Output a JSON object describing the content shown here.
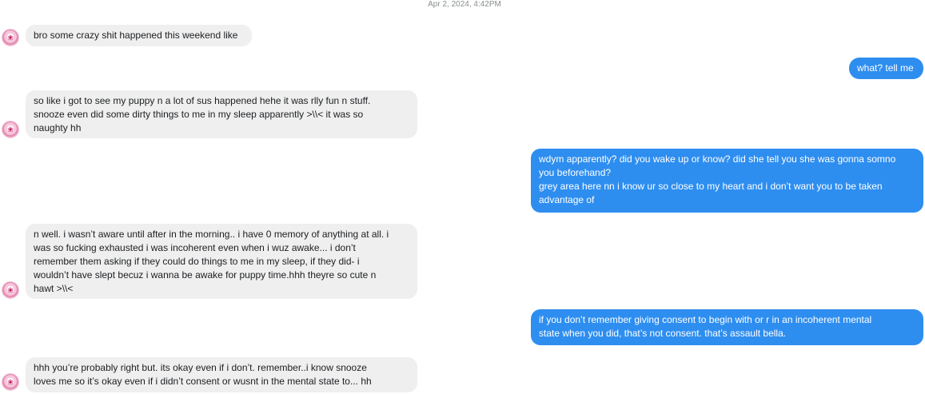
{
  "conversation": {
    "timestamp": "Apr 2, 2024, 4:42PM",
    "contact_avatar_icon": "pink-round-avatar-icon",
    "colors": {
      "incoming_bubble": "#efefef",
      "outgoing_bubble": "#2e8ef0",
      "timestamp_text": "#8a8d91"
    },
    "messages": [
      {
        "sender": "them",
        "lines": [
          "bro some crazy shit happened this weekend like"
        ]
      },
      {
        "sender": "me",
        "lines": [
          "what? tell me"
        ]
      },
      {
        "sender": "them",
        "lines": [
          "so like i got to see my puppy n a lot of sus happened hehe it was rlly fun n stuff.",
          "snooze even did some dirty things to me in my sleep apparently >\\\\< it was so",
          "naughty hh"
        ]
      },
      {
        "sender": "me",
        "lines": [
          "wdym apparently? did you wake up or know? did she tell you she was gonna somno",
          "you beforehand?",
          "grey area here nn i know ur so close to my heart and i don’t want you to be taken",
          "advantage of"
        ]
      },
      {
        "sender": "them",
        "lines": [
          "n well. i wasn’t aware until after in the morning.. i have 0 memory of anything at all. i",
          "was so fucking exhausted i was incoherent even when i wuz awake... i don’t",
          "remember them asking if they could do things to me in my sleep, if they did- i",
          "wouldn’t have slept becuz i wanna be awake for puppy time.hhh theyre so cute n",
          "hawt >\\\\<"
        ]
      },
      {
        "sender": "me",
        "lines": [
          "if you don’t remember giving consent to begin with or r in an incoherent mental",
          "state when you did, that’s not consent. that’s assault bella."
        ]
      },
      {
        "sender": "them",
        "lines": [
          "hhh you’re probably right but.  its okay even if i don’t. remember..i know snooze",
          "loves me so it’s okay even if i didn’t consent or wusnt in the mental state to... hh"
        ]
      }
    ]
  }
}
